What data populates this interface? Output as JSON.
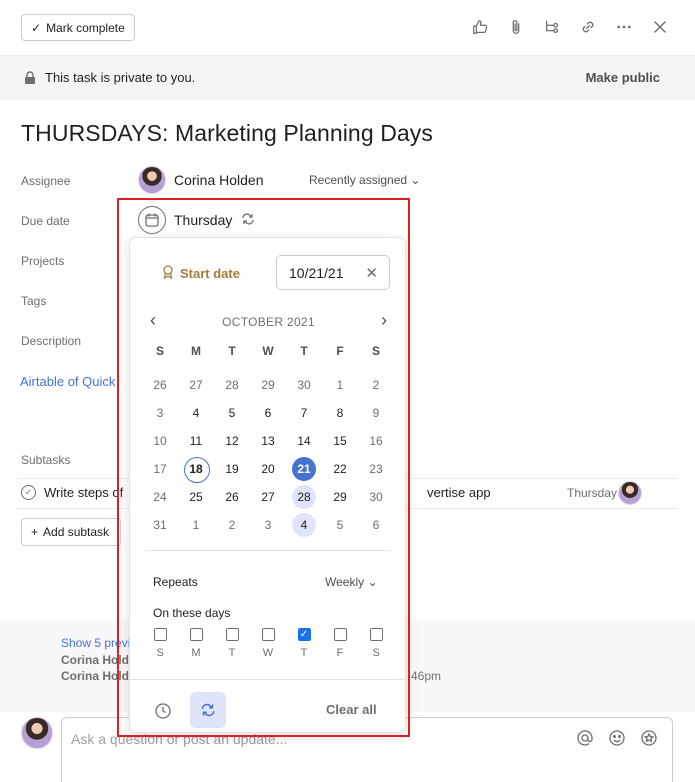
{
  "header": {
    "mark_complete": "Mark complete",
    "icons": [
      "thumbs-up-icon",
      "paperclip-icon",
      "subtask-icon",
      "link-icon",
      "more-icon",
      "close-icon"
    ]
  },
  "privacy": {
    "text": "This task is private to you.",
    "make_public": "Make public"
  },
  "task": {
    "title": "THURSDAYS: Marketing Planning Days",
    "fields": {
      "assignee_label": "Assignee",
      "due_date_label": "Due date",
      "projects_label": "Projects",
      "tags_label": "Tags",
      "description_label": "Description"
    },
    "assignee_name": "Corina Holden",
    "recently_assigned": "Recently assigned",
    "due_value": "Thursday",
    "description_link": "Airtable of Quick"
  },
  "subtasks": {
    "label": "Subtasks",
    "items": [
      {
        "text_left": "Write steps of",
        "text_right": "vertise app",
        "date": "Thursday"
      }
    ],
    "add_label": "Add subtask"
  },
  "activity": {
    "show_previous": "Show 5 previ",
    "name1": "Corina Holde",
    "name2": "Corina Holde",
    "time": "46pm"
  },
  "comment": {
    "placeholder": "Ask a question or post an update..."
  },
  "date_picker": {
    "start_date_label": "Start date",
    "date_value": "10/21/21",
    "month_label": "OCTOBER 2021",
    "weekdays": [
      "S",
      "M",
      "T",
      "W",
      "T",
      "F",
      "S"
    ],
    "days": [
      {
        "n": "26",
        "t": "muted"
      },
      {
        "n": "27",
        "t": "muted"
      },
      {
        "n": "28",
        "t": "muted"
      },
      {
        "n": "29",
        "t": "muted"
      },
      {
        "n": "30",
        "t": "muted"
      },
      {
        "n": "1",
        "t": "muted"
      },
      {
        "n": "2",
        "t": "muted"
      },
      {
        "n": "3",
        "t": "muted"
      },
      {
        "n": "4",
        "t": ""
      },
      {
        "n": "5",
        "t": ""
      },
      {
        "n": "6",
        "t": ""
      },
      {
        "n": "7",
        "t": ""
      },
      {
        "n": "8",
        "t": ""
      },
      {
        "n": "9",
        "t": "muted"
      },
      {
        "n": "10",
        "t": "muted"
      },
      {
        "n": "11",
        "t": ""
      },
      {
        "n": "12",
        "t": ""
      },
      {
        "n": "13",
        "t": ""
      },
      {
        "n": "14",
        "t": ""
      },
      {
        "n": "15",
        "t": ""
      },
      {
        "n": "16",
        "t": "muted"
      },
      {
        "n": "17",
        "t": "muted"
      },
      {
        "n": "18",
        "t": "today"
      },
      {
        "n": "19",
        "t": ""
      },
      {
        "n": "20",
        "t": ""
      },
      {
        "n": "21",
        "t": "selected"
      },
      {
        "n": "22",
        "t": ""
      },
      {
        "n": "23",
        "t": "muted"
      },
      {
        "n": "24",
        "t": "muted"
      },
      {
        "n": "25",
        "t": ""
      },
      {
        "n": "26",
        "t": ""
      },
      {
        "n": "27",
        "t": ""
      },
      {
        "n": "28",
        "t": "recur"
      },
      {
        "n": "29",
        "t": ""
      },
      {
        "n": "30",
        "t": "muted"
      },
      {
        "n": "31",
        "t": "muted"
      },
      {
        "n": "1",
        "t": "muted"
      },
      {
        "n": "2",
        "t": "muted"
      },
      {
        "n": "3",
        "t": "muted"
      },
      {
        "n": "4",
        "t": "recur"
      },
      {
        "n": "5",
        "t": "muted"
      },
      {
        "n": "6",
        "t": "muted"
      }
    ],
    "repeats_label": "Repeats",
    "repeats_value": "Weekly",
    "on_days_label": "On these days",
    "on_days": [
      {
        "label": "S",
        "checked": false
      },
      {
        "label": "M",
        "checked": false
      },
      {
        "label": "T",
        "checked": false
      },
      {
        "label": "W",
        "checked": false
      },
      {
        "label": "T",
        "checked": true
      },
      {
        "label": "F",
        "checked": false
      },
      {
        "label": "S",
        "checked": false
      }
    ],
    "clear_all": "Clear all"
  },
  "colors": {
    "accent_blue": "#4573d2",
    "start_date_gold": "#a47d3e",
    "highlight_red": "#e02020",
    "checkbox_blue": "#1a73e8"
  }
}
